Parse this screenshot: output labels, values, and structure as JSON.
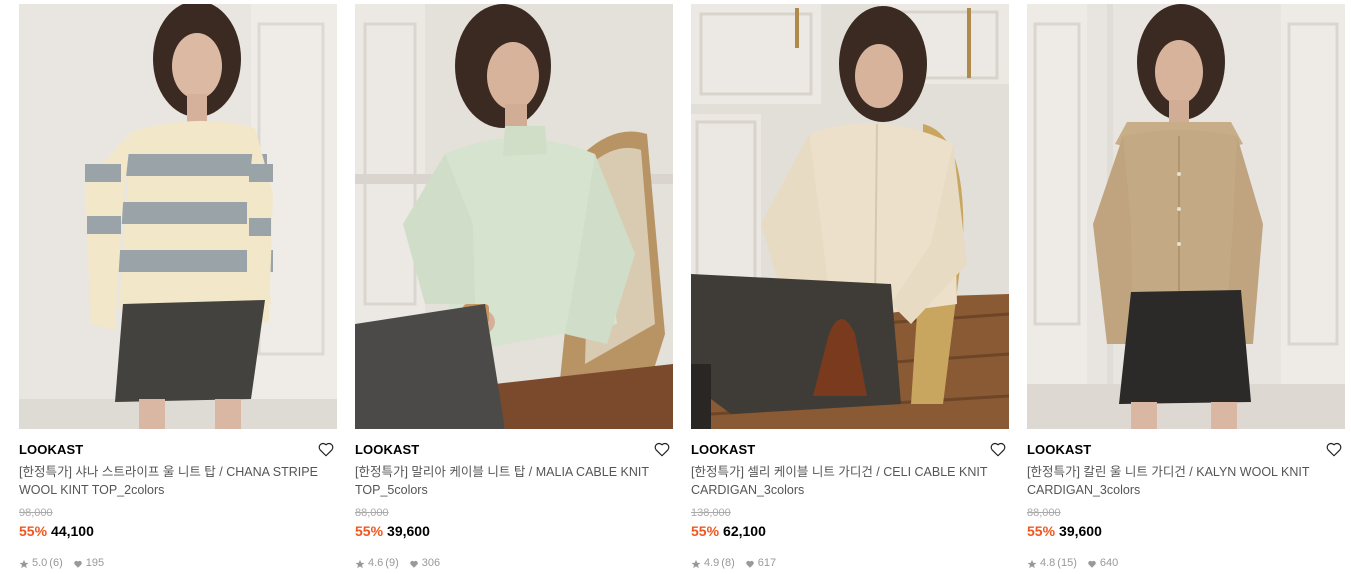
{
  "products": [
    {
      "brand": "LOOKAST",
      "name": "[한정특가] 샤나 스트라이프 울 니트 탑 / CHANA STRIPE WOOL KINT TOP_2colors",
      "original_price": "98,000",
      "discount": "55%",
      "price": "44,100",
      "rating": "5.0",
      "review_count": "(6)",
      "likes": "195"
    },
    {
      "brand": "LOOKAST",
      "name": "[한정특가] 말리아 케이블 니트 탑 / MALIA CABLE KNIT TOP_5colors",
      "original_price": "88,000",
      "discount": "55%",
      "price": "39,600",
      "rating": "4.6",
      "review_count": "(9)",
      "likes": "306"
    },
    {
      "brand": "LOOKAST",
      "name": "[한정특가] 셀리 케이블 니트 가디건 / CELI CABLE KNIT CARDIGAN_3colors",
      "original_price": "138,000",
      "discount": "55%",
      "price": "62,100",
      "rating": "4.9",
      "review_count": "(8)",
      "likes": "617"
    },
    {
      "brand": "LOOKAST",
      "name": "[한정특가] 칼린 울 니트 가디건 / KALYN WOOL KNIT CARDIGAN_3colors",
      "original_price": "88,000",
      "discount": "55%",
      "price": "39,600",
      "rating": "4.8",
      "review_count": "(15)",
      "likes": "640"
    }
  ],
  "colors": {
    "discount": "#f1561e",
    "original_price": "#aaaaaa",
    "meta": "#999999"
  },
  "icons": {
    "wishlist": "heart-outline-icon",
    "rating": "star-icon",
    "likes": "heart-filled-icon"
  }
}
